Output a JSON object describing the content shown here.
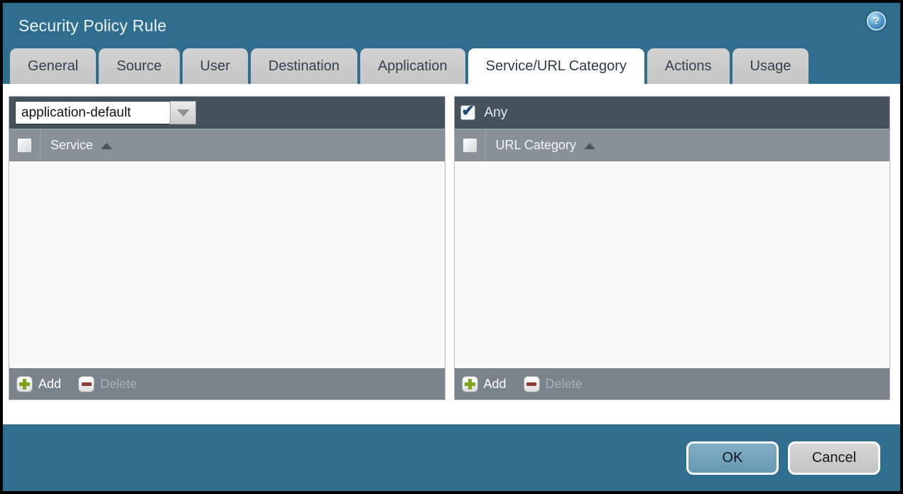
{
  "window": {
    "title": "Security Policy Rule"
  },
  "tabs": [
    {
      "label": "General",
      "active": false
    },
    {
      "label": "Source",
      "active": false
    },
    {
      "label": "User",
      "active": false
    },
    {
      "label": "Destination",
      "active": false
    },
    {
      "label": "Application",
      "active": false
    },
    {
      "label": "Service/URL Category",
      "active": true
    },
    {
      "label": "Actions",
      "active": false
    },
    {
      "label": "Usage",
      "active": false
    }
  ],
  "service_panel": {
    "dropdown_value": "application-default",
    "column_header": "Service",
    "sort_direction": "ascending",
    "select_all_checked": false,
    "rows": [],
    "add_label": "Add",
    "delete_label": "Delete",
    "delete_enabled": false
  },
  "url_category_panel": {
    "any_label": "Any",
    "any_checked": true,
    "column_header": "URL Category",
    "sort_direction": "ascending",
    "select_all_checked": false,
    "rows": [],
    "add_label": "Add",
    "delete_label": "Delete",
    "delete_enabled": false
  },
  "footer": {
    "ok_label": "OK",
    "cancel_label": "Cancel"
  },
  "colors": {
    "background": "#2f6e8e",
    "panel_toolbar": "#46525c",
    "panel_header": "#87919a",
    "panel_footer": "#79838b",
    "tab_inactive": "#c9c9c9",
    "tab_active": "#ffffff",
    "ok_button": "#74a6be",
    "cancel_button": "#cccccc",
    "checkbox_check": "#1d4a74",
    "add_plus": "#7da41b",
    "delete_minus": "#8e3b3b"
  }
}
